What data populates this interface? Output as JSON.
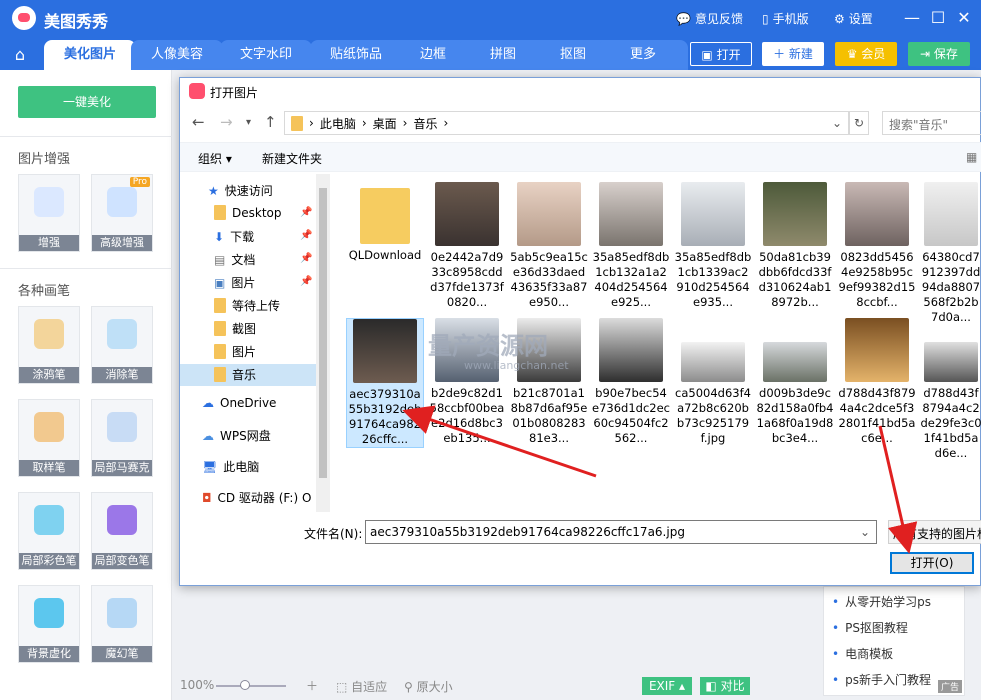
{
  "app": {
    "title": "美图秀秀",
    "actions": [
      "意见反馈",
      "手机版",
      "设置"
    ],
    "window_controls": [
      "—",
      "☐",
      "✕"
    ]
  },
  "tabs": [
    "美化图片",
    "人像美容",
    "文字水印",
    "贴纸饰品",
    "边框",
    "拼图",
    "抠图",
    "更多"
  ],
  "toolbar": {
    "open": "打开",
    "new": "新建",
    "vip": "会员",
    "save": "保存"
  },
  "sidebar": {
    "beautify_button": "一键美化",
    "enhance_title": "图片增强",
    "enhance_tools": [
      "增强",
      "高级增强"
    ],
    "pro_badge": "Pro",
    "brush_title": "各种画笔",
    "brush_tools": [
      "涂鸦笔",
      "消除笔",
      "取样笔",
      "局部马赛克",
      "局部彩色笔",
      "局部变色笔",
      "背景虚化",
      "魔幻笔"
    ]
  },
  "bottom_bar": {
    "zoom": "100%",
    "fit": "自适应",
    "original": "原大小",
    "exif": "EXIF",
    "compare": "对比"
  },
  "right_panel": {
    "items": [
      "从零开始学习ps",
      "PS抠图教程",
      "电商模板",
      "ps新手入门教程"
    ],
    "ad": "广告"
  },
  "dialog": {
    "title": "打开图片",
    "breadcrumb": [
      "此电脑",
      "桌面",
      "音乐"
    ],
    "search_placeholder": "搜索\"音乐\"",
    "organize": "组织 ▾",
    "new_folder": "新建文件夹",
    "nav_items": [
      "快速访问",
      "Desktop",
      "下载",
      "文档",
      "图片",
      "等待上传",
      "截图",
      "图片",
      "音乐",
      "OneDrive",
      "WPS网盘",
      "此电脑",
      "CD 驱动器 (F:) O"
    ],
    "files": [
      "QLDownload",
      "0e2442a7d933c8958cddd37fde1373f0820...",
      "5ab5c9ea15ce36d33daed43635f33a87e950...",
      "35a85edf8db1cb132a1a2404d254564e925...",
      "35a85edf8db1cb1339ac2910d254564e935...",
      "50da81cb39dbb6fdcd33fd310624ab18972b...",
      "0823dd54564e9258b95c9ef99382d158ccbf...",
      "64380cd7912397dd94da8807568f2b2b7d0a...",
      "aec379310a55b3192deb91764ca98226cffc...",
      "b2de9c82d158ccbf00beae2d16d8bc3eb135...",
      "b21c8701a18b87d6af95e01b080828381e3...",
      "b90e7bec54e736d1dc2ec60c94504fc2562...",
      "ca5004d63f4a72b8c620bb73c925179f.jpg",
      "d009b3de9c82d158a0fb41a68f0a19d8bc3e4...",
      "d788d43f8794a4c2dce5f32801f41bd5ac6e...",
      "d788d43f8794a4c2de29fe3c01f41bd5ad6e..."
    ],
    "filename_label": "文件名(N):",
    "filename_value": "aec379310a55b3192deb91764ca98226cffc17a6.jpg",
    "filetype": "所有支持的图片格",
    "open_button": "打开(O)"
  },
  "watermark": "量产资源网",
  "watermark_url": "www.liangchan.net",
  "colors": {
    "brand": "#2b6fe0",
    "green": "#3ec281",
    "vip": "#f5c000"
  }
}
